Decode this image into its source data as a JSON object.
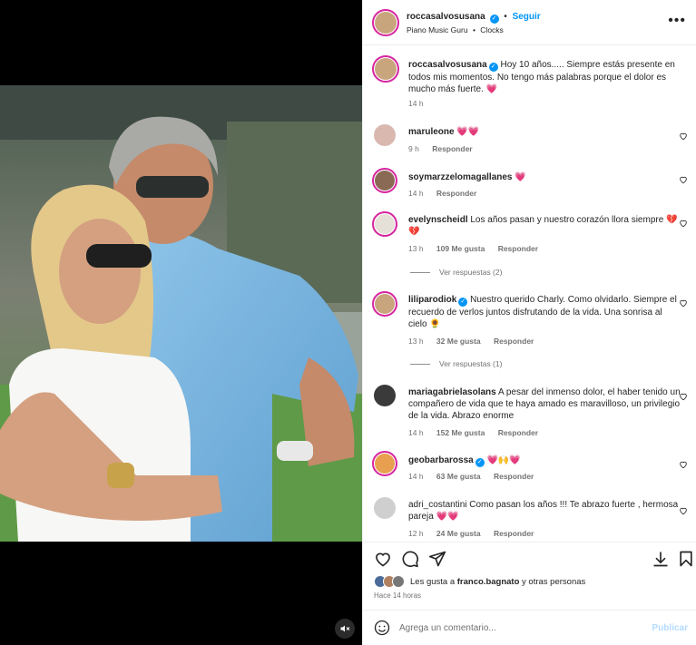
{
  "post": {
    "author": "roccasalvosusana",
    "follow_label": "Seguir",
    "separator": "•",
    "music": "Piano Music Guru",
    "music_track": "Clocks",
    "caption": "Hoy 10 años..... Siempre estás presente en todos mis momentos. No tengo más palabras porque el dolor es mucho más fuerte.",
    "caption_time": "14 h"
  },
  "comments": [
    {
      "user": "maruleone",
      "text": "",
      "emoji": "💗💗",
      "time": "9 h",
      "likes": "",
      "reply": "Responder"
    },
    {
      "user": "soymarzzelomagallanes",
      "text": "",
      "emoji": "💗",
      "time": "14 h",
      "likes": "",
      "reply": "Responder"
    },
    {
      "user": "evelynscheidl",
      "text": "Los años pasan y nuestro corazón llora siempre",
      "emoji": "💔💔",
      "time": "13 h",
      "likes": "109 Me gusta",
      "reply": "Responder",
      "view_replies": "Ver respuestas (2)"
    },
    {
      "user": "liliparodiok",
      "verified": true,
      "text": "Nuestro querido Charly. Como olvidarlo. Siempre el recuerdo de verlos juntos disfrutando de la vida. Una sonrisa al cielo",
      "emoji": "🌻",
      "time": "13 h",
      "likes": "32 Me gusta",
      "reply": "Responder",
      "view_replies": "Ver respuestas (1)"
    },
    {
      "user": "mariagabrielasolans",
      "text": "A pesar del inmenso dolor, el haber tenido un compañero de vida que te haya amado es maravilloso, un privilegio de la vida. Abrazo enorme",
      "emoji": "",
      "time": "14 h",
      "likes": "152 Me gusta",
      "reply": "Responder"
    },
    {
      "user": "geobarbarossa",
      "verified": true,
      "text": "",
      "emoji": "💗🙌💗",
      "time": "14 h",
      "likes": "63 Me gusta",
      "reply": "Responder"
    },
    {
      "user": "adri_costantini",
      "text": "Como pasan los años !!! Te abrazo fuerte , hermosa pareja",
      "emoji": "💗💗",
      "time": "12 h",
      "likes": "24 Me gusta",
      "reply": "Responder"
    }
  ],
  "footer": {
    "likes_prefix": "Les gusta a",
    "likes_user": "franco.bagnato",
    "likes_suffix": "y otras personas",
    "posted": "Hace 14 horas",
    "comment_placeholder": "Agrega un comentario...",
    "publish_label": "Publicar"
  },
  "icons": {
    "like": "heart-icon",
    "comment": "comment-icon",
    "share": "send-icon",
    "save": "bookmark-icon",
    "emoji": "smile-icon",
    "more": "more-icon",
    "mute": "mute-icon"
  },
  "colors": {
    "link": "#0095f6",
    "muted": "#737373",
    "accent": "#e0245e"
  }
}
